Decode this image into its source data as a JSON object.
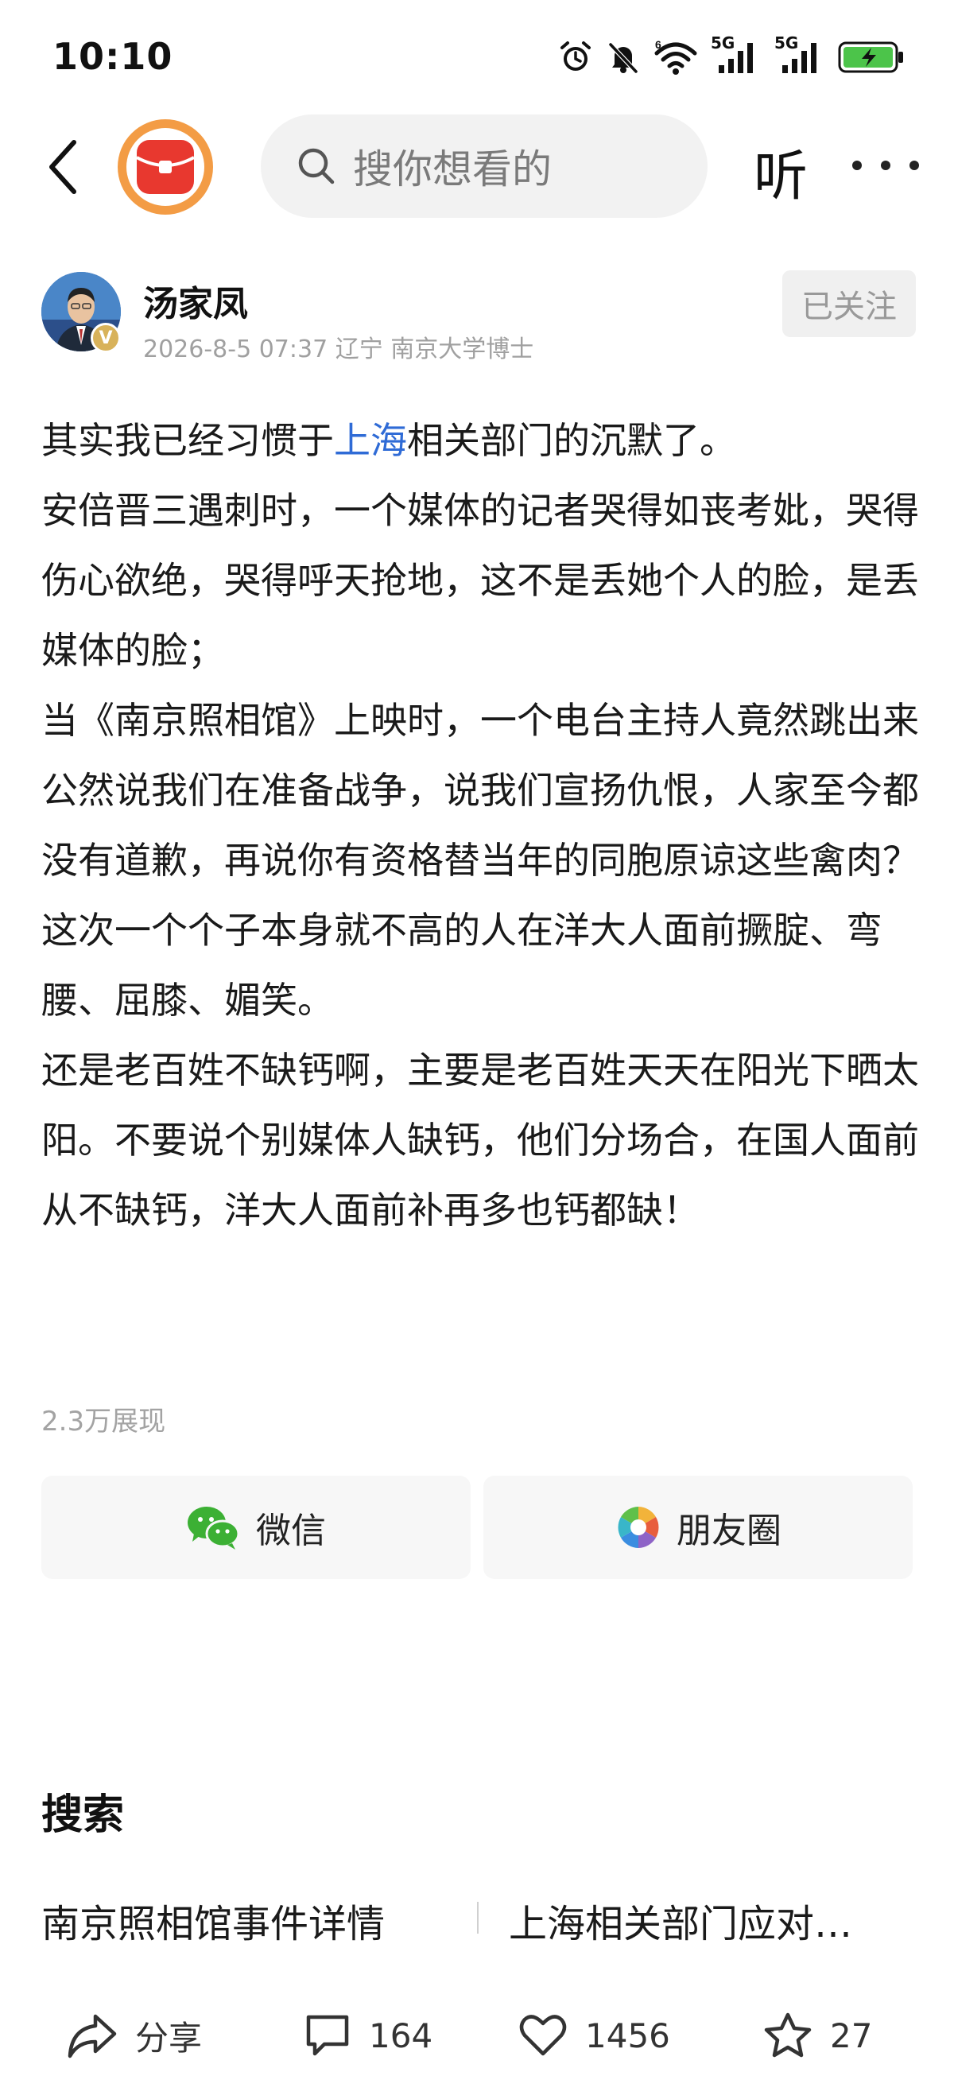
{
  "status_bar": {
    "time": "10:10",
    "icons": [
      "alarm-icon",
      "mute-bell-icon",
      "wifi-icon",
      "5g-signal-icon",
      "5g-signal-icon",
      "battery-charging-icon"
    ],
    "signal_tag": "5G",
    "wifi_tag": "6"
  },
  "header": {
    "search_placeholder": "搜你想看的",
    "listen_label": "听",
    "logo_color": "#e8382f",
    "logo_ring_color": "#f39c45"
  },
  "author": {
    "name": "汤家凤",
    "verified_badge": "V",
    "meta": "2026-8-5 07:37 辽宁  南京大学博士",
    "follow_label": "已关注"
  },
  "article": {
    "line1_before": "其实我已经习惯于",
    "line1_link": "上海",
    "line1_after": "相关部门的沉默了。",
    "p2": "安倍晋三遇刺时，一个媒体的记者哭得如丧考妣，哭得伤心欲绝，哭得呼天抢地，这不是丢她个人的脸，是丢媒体的脸；",
    "p3": "当《南京照相馆》上映时，一个电台主持人竟然跳出来公然说我们在准备战争，说我们宣扬仇恨，人家至今都没有道歉，再说你有资格替当年的同胞原谅这些禽肉？",
    "p4": "这次一个个子本身就不高的人在洋大人面前撅腚、弯腰、屈膝、媚笑。",
    "p5": "还是老百姓不缺钙啊，主要是老百姓天天在阳光下晒太阳。不要说个别媒体人缺钙，他们分场合，在国人面前从不缺钙，洋大人面前补再多也钙都缺！",
    "views": "2.3万展现",
    "link_color": "#2f6bd6"
  },
  "share": {
    "wechat_label": "微信",
    "moments_label": "朋友圈"
  },
  "search_section": {
    "title": "搜索",
    "suggestions": [
      "南京照相馆事件详情",
      "上海相关部门应对…"
    ]
  },
  "bottom_bar": {
    "share_label": "分享",
    "comments": "164",
    "likes": "1456",
    "favorites": "27"
  }
}
